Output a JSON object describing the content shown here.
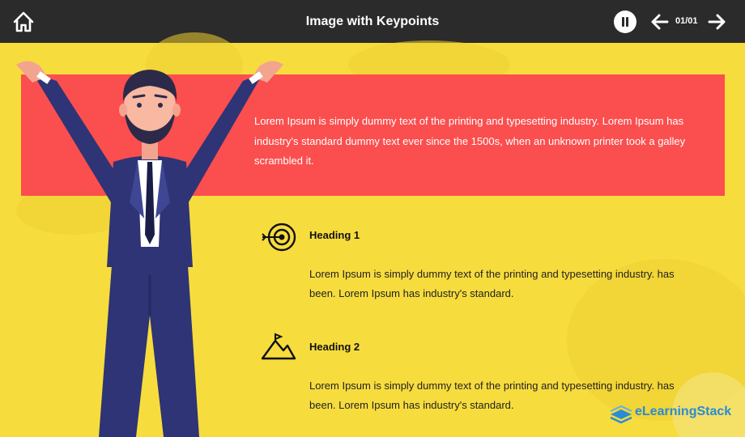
{
  "header": {
    "title": "Image with Keypoints",
    "counter": "01/01"
  },
  "banner": {
    "text": "Lorem Ipsum is simply dummy text of the printing and typesetting industry. Lorem Ipsum has industry's standard dummy text ever since the 1500s, when an unknown printer took a galley scrambled it."
  },
  "keypoints": [
    {
      "icon": "target-icon",
      "heading": "Heading 1",
      "text": "Lorem Ipsum is simply dummy text of the printing and typesetting industry. has been. Lorem Ipsum has industry's standard."
    },
    {
      "icon": "mountain-flag-icon",
      "heading": "Heading 2",
      "text": "Lorem Ipsum is simply dummy text of the printing and typesetting industry. has been. Lorem Ipsum has industry's standard."
    }
  ],
  "brand": {
    "name": "eLearningStack"
  },
  "colors": {
    "background": "#f7dc3e",
    "topbar": "#2b2b2b",
    "banner": "#fb4e4e",
    "suit": "#2e3475"
  }
}
